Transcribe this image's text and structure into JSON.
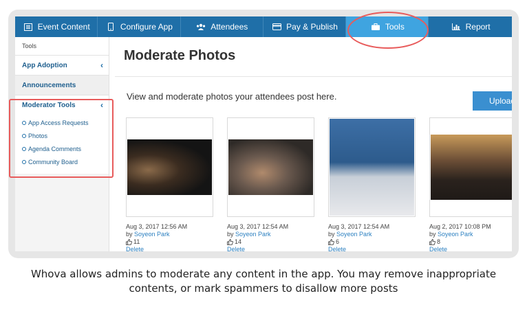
{
  "nav": {
    "tabs": [
      {
        "label": "Event Content",
        "icon": "list-icon"
      },
      {
        "label": "Configure App",
        "icon": "phone-icon"
      },
      {
        "label": "Attendees",
        "icon": "people-icon"
      },
      {
        "label": "Pay & Publish",
        "icon": "credit-card-icon"
      },
      {
        "label": "Tools",
        "icon": "briefcase-icon",
        "active": true
      },
      {
        "label": "Report",
        "icon": "bar-chart-icon"
      }
    ]
  },
  "sidebar": {
    "crumb": "Tools",
    "items": [
      {
        "label": "App Adoption"
      },
      {
        "label": "Announcements"
      },
      {
        "label": "Moderator Tools"
      }
    ],
    "sub_items": [
      {
        "label": "App Access Requests"
      },
      {
        "label": "Photos"
      },
      {
        "label": "Agenda Comments"
      },
      {
        "label": "Community Board"
      }
    ]
  },
  "main": {
    "title": "Moderate Photos",
    "description": "View and moderate photos your attendees post here.",
    "upload_label": "Upload P",
    "photos": [
      {
        "date": "Aug 3, 2017 12:56 AM",
        "by_prefix": "by",
        "author": "Soyeon Park",
        "likes": "11",
        "delete_label": "Delete"
      },
      {
        "date": "Aug 3, 2017 12:54 AM",
        "by_prefix": "by",
        "author": "Soyeon Park",
        "likes": "14",
        "delete_label": "Delete"
      },
      {
        "date": "Aug 3, 2017 12:54 AM",
        "by_prefix": "by",
        "author": "Soyeon Park",
        "likes": "6",
        "delete_label": "Delete"
      },
      {
        "date": "Aug 2, 2017 10:08 PM",
        "by_prefix": "by",
        "author": "Soyeon Park",
        "likes": "8",
        "delete_label": "Delete"
      }
    ]
  },
  "caption": {
    "line1": "Whova allows admins to moderate any content in the app. You may remove inappropriate",
    "line2": "contents, or  mark spammers to disallow more posts"
  },
  "colors": {
    "nav": "#1f6fa8",
    "active_tab": "#3fa4e0",
    "annotation": "#e85b5b",
    "link": "#2a7fc0"
  }
}
